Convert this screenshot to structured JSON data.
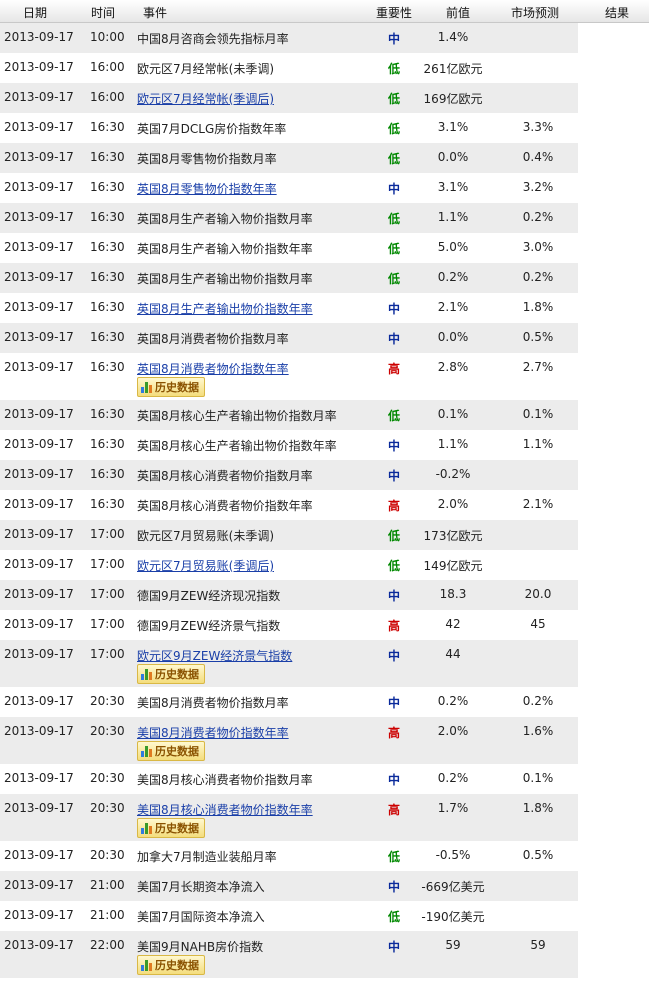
{
  "header": {
    "date": "日期",
    "time": "时间",
    "event": "事件",
    "importance": "重要性",
    "previous": "前值",
    "forecast": "市场预测",
    "result": "结果"
  },
  "history_label": "历史数据",
  "importance_colors": {
    "低": "#008800",
    "中": "#0a2a9b",
    "高": "#cc0000"
  },
  "rows": [
    {
      "date": "2013-09-17",
      "time": "10:00",
      "event": "中国8月咨商会领先指标月率",
      "link": false,
      "importance": "中",
      "previous": "1.4%",
      "forecast": "",
      "history": false
    },
    {
      "date": "2013-09-17",
      "time": "16:00",
      "event": "欧元区7月经常帐(未季调)",
      "link": false,
      "importance": "低",
      "previous": "261亿欧元",
      "forecast": "",
      "history": false
    },
    {
      "date": "2013-09-17",
      "time": "16:00",
      "event": "欧元区7月经常帐(季调后)",
      "link": true,
      "importance": "低",
      "previous": "169亿欧元",
      "forecast": "",
      "history": false
    },
    {
      "date": "2013-09-17",
      "time": "16:30",
      "event": "英国7月DCLG房价指数年率",
      "link": false,
      "importance": "低",
      "previous": "3.1%",
      "forecast": "3.3%",
      "history": false
    },
    {
      "date": "2013-09-17",
      "time": "16:30",
      "event": "英国8月零售物价指数月率",
      "link": false,
      "importance": "低",
      "previous": "0.0%",
      "forecast": "0.4%",
      "history": false
    },
    {
      "date": "2013-09-17",
      "time": "16:30",
      "event": "英国8月零售物价指数年率",
      "link": true,
      "importance": "中",
      "previous": "3.1%",
      "forecast": "3.2%",
      "history": false
    },
    {
      "date": "2013-09-17",
      "time": "16:30",
      "event": "英国8月生产者输入物价指数月率",
      "link": false,
      "importance": "低",
      "previous": "1.1%",
      "forecast": "0.2%",
      "history": false
    },
    {
      "date": "2013-09-17",
      "time": "16:30",
      "event": "英国8月生产者输入物价指数年率",
      "link": false,
      "importance": "低",
      "previous": "5.0%",
      "forecast": "3.0%",
      "history": false
    },
    {
      "date": "2013-09-17",
      "time": "16:30",
      "event": "英国8月生产者输出物价指数月率",
      "link": false,
      "importance": "低",
      "previous": "0.2%",
      "forecast": "0.2%",
      "history": false
    },
    {
      "date": "2013-09-17",
      "time": "16:30",
      "event": "英国8月生产者输出物价指数年率",
      "link": true,
      "importance": "中",
      "previous": "2.1%",
      "forecast": "1.8%",
      "history": false
    },
    {
      "date": "2013-09-17",
      "time": "16:30",
      "event": "英国8月消费者物价指数月率",
      "link": false,
      "importance": "中",
      "previous": "0.0%",
      "forecast": "0.5%",
      "history": false
    },
    {
      "date": "2013-09-17",
      "time": "16:30",
      "event": "英国8月消费者物价指数年率",
      "link": true,
      "importance": "高",
      "previous": "2.8%",
      "forecast": "2.7%",
      "history": true
    },
    {
      "date": "2013-09-17",
      "time": "16:30",
      "event": "英国8月核心生产者输出物价指数月率",
      "link": false,
      "importance": "低",
      "previous": "0.1%",
      "forecast": "0.1%",
      "history": false
    },
    {
      "date": "2013-09-17",
      "time": "16:30",
      "event": "英国8月核心生产者输出物价指数年率",
      "link": false,
      "importance": "中",
      "previous": "1.1%",
      "forecast": "1.1%",
      "history": false
    },
    {
      "date": "2013-09-17",
      "time": "16:30",
      "event": "英国8月核心消费者物价指数月率",
      "link": false,
      "importance": "中",
      "previous": "-0.2%",
      "forecast": "",
      "history": false
    },
    {
      "date": "2013-09-17",
      "time": "16:30",
      "event": "英国8月核心消费者物价指数年率",
      "link": false,
      "importance": "高",
      "previous": "2.0%",
      "forecast": "2.1%",
      "history": false
    },
    {
      "date": "2013-09-17",
      "time": "17:00",
      "event": "欧元区7月贸易账(未季调)",
      "link": false,
      "importance": "低",
      "previous": "173亿欧元",
      "forecast": "",
      "history": false
    },
    {
      "date": "2013-09-17",
      "time": "17:00",
      "event": "欧元区7月贸易账(季调后)",
      "link": true,
      "importance": "低",
      "previous": "149亿欧元",
      "forecast": "",
      "history": false
    },
    {
      "date": "2013-09-17",
      "time": "17:00",
      "event": "德国9月ZEW经济现况指数",
      "link": false,
      "importance": "中",
      "previous": "18.3",
      "forecast": "20.0",
      "history": false
    },
    {
      "date": "2013-09-17",
      "time": "17:00",
      "event": "德国9月ZEW经济景气指数",
      "link": false,
      "importance": "高",
      "previous": "42",
      "forecast": "45",
      "history": false
    },
    {
      "date": "2013-09-17",
      "time": "17:00",
      "event": "欧元区9月ZEW经济景气指数",
      "link": true,
      "importance": "中",
      "previous": "44",
      "forecast": "",
      "history": true
    },
    {
      "date": "2013-09-17",
      "time": "20:30",
      "event": "美国8月消费者物价指数月率",
      "link": false,
      "importance": "中",
      "previous": "0.2%",
      "forecast": "0.2%",
      "history": false
    },
    {
      "date": "2013-09-17",
      "time": "20:30",
      "event": "美国8月消费者物价指数年率",
      "link": true,
      "importance": "高",
      "previous": "2.0%",
      "forecast": "1.6%",
      "history": true
    },
    {
      "date": "2013-09-17",
      "time": "20:30",
      "event": "美国8月核心消费者物价指数月率",
      "link": false,
      "importance": "中",
      "previous": "0.2%",
      "forecast": "0.1%",
      "history": false
    },
    {
      "date": "2013-09-17",
      "time": "20:30",
      "event": "美国8月核心消费者物价指数年率",
      "link": true,
      "importance": "高",
      "previous": "1.7%",
      "forecast": "1.8%",
      "history": true
    },
    {
      "date": "2013-09-17",
      "time": "20:30",
      "event": "加拿大7月制造业装船月率",
      "link": false,
      "importance": "低",
      "previous": "-0.5%",
      "forecast": "0.5%",
      "history": false
    },
    {
      "date": "2013-09-17",
      "time": "21:00",
      "event": "美国7月长期资本净流入",
      "link": false,
      "importance": "中",
      "previous": "-669亿美元",
      "forecast": "",
      "history": false
    },
    {
      "date": "2013-09-17",
      "time": "21:00",
      "event": "美国7月国际资本净流入",
      "link": false,
      "importance": "低",
      "previous": "-190亿美元",
      "forecast": "",
      "history": false
    },
    {
      "date": "2013-09-17",
      "time": "22:00",
      "event": "美国9月NAHB房价指数",
      "link": false,
      "importance": "中",
      "previous": "59",
      "forecast": "59",
      "history": true
    }
  ]
}
